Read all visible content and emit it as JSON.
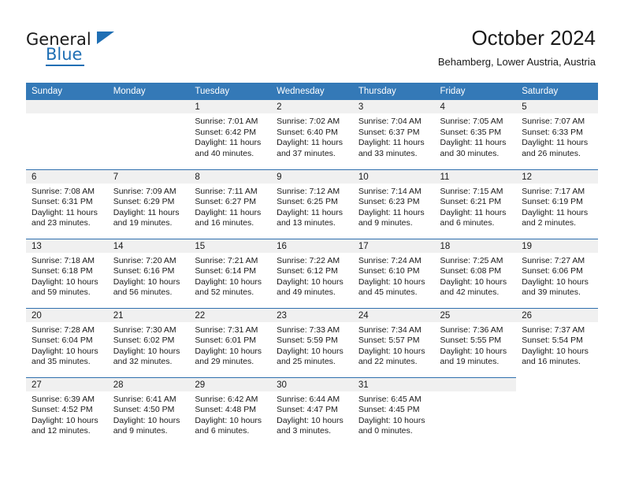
{
  "brand": {
    "name_part1": "General",
    "name_part2": "Blue",
    "accent_color": "#1f6fb4"
  },
  "header": {
    "title": "October 2024",
    "subtitle": "Behamberg, Lower Austria, Austria"
  },
  "calendar": {
    "header_bg": "#3479b7",
    "row_divider_color": "#2f6fae",
    "daynum_band_bg": "#f0f0f0",
    "weekday_headers": [
      "Sunday",
      "Monday",
      "Tuesday",
      "Wednesday",
      "Thursday",
      "Friday",
      "Saturday"
    ],
    "weeks": [
      [
        {
          "day": "",
          "blank": true,
          "sunrise": "",
          "sunset": "",
          "daylight": ""
        },
        {
          "day": "",
          "blank": true,
          "sunrise": "",
          "sunset": "",
          "daylight": ""
        },
        {
          "day": "1",
          "sunrise": "Sunrise: 7:01 AM",
          "sunset": "Sunset: 6:42 PM",
          "daylight": "Daylight: 11 hours and 40 minutes."
        },
        {
          "day": "2",
          "sunrise": "Sunrise: 7:02 AM",
          "sunset": "Sunset: 6:40 PM",
          "daylight": "Daylight: 11 hours and 37 minutes."
        },
        {
          "day": "3",
          "sunrise": "Sunrise: 7:04 AM",
          "sunset": "Sunset: 6:37 PM",
          "daylight": "Daylight: 11 hours and 33 minutes."
        },
        {
          "day": "4",
          "sunrise": "Sunrise: 7:05 AM",
          "sunset": "Sunset: 6:35 PM",
          "daylight": "Daylight: 11 hours and 30 minutes."
        },
        {
          "day": "5",
          "sunrise": "Sunrise: 7:07 AM",
          "sunset": "Sunset: 6:33 PM",
          "daylight": "Daylight: 11 hours and 26 minutes."
        }
      ],
      [
        {
          "day": "6",
          "sunrise": "Sunrise: 7:08 AM",
          "sunset": "Sunset: 6:31 PM",
          "daylight": "Daylight: 11 hours and 23 minutes."
        },
        {
          "day": "7",
          "sunrise": "Sunrise: 7:09 AM",
          "sunset": "Sunset: 6:29 PM",
          "daylight": "Daylight: 11 hours and 19 minutes."
        },
        {
          "day": "8",
          "sunrise": "Sunrise: 7:11 AM",
          "sunset": "Sunset: 6:27 PM",
          "daylight": "Daylight: 11 hours and 16 minutes."
        },
        {
          "day": "9",
          "sunrise": "Sunrise: 7:12 AM",
          "sunset": "Sunset: 6:25 PM",
          "daylight": "Daylight: 11 hours and 13 minutes."
        },
        {
          "day": "10",
          "sunrise": "Sunrise: 7:14 AM",
          "sunset": "Sunset: 6:23 PM",
          "daylight": "Daylight: 11 hours and 9 minutes."
        },
        {
          "day": "11",
          "sunrise": "Sunrise: 7:15 AM",
          "sunset": "Sunset: 6:21 PM",
          "daylight": "Daylight: 11 hours and 6 minutes."
        },
        {
          "day": "12",
          "sunrise": "Sunrise: 7:17 AM",
          "sunset": "Sunset: 6:19 PM",
          "daylight": "Daylight: 11 hours and 2 minutes."
        }
      ],
      [
        {
          "day": "13",
          "sunrise": "Sunrise: 7:18 AM",
          "sunset": "Sunset: 6:18 PM",
          "daylight": "Daylight: 10 hours and 59 minutes."
        },
        {
          "day": "14",
          "sunrise": "Sunrise: 7:20 AM",
          "sunset": "Sunset: 6:16 PM",
          "daylight": "Daylight: 10 hours and 56 minutes."
        },
        {
          "day": "15",
          "sunrise": "Sunrise: 7:21 AM",
          "sunset": "Sunset: 6:14 PM",
          "daylight": "Daylight: 10 hours and 52 minutes."
        },
        {
          "day": "16",
          "sunrise": "Sunrise: 7:22 AM",
          "sunset": "Sunset: 6:12 PM",
          "daylight": "Daylight: 10 hours and 49 minutes."
        },
        {
          "day": "17",
          "sunrise": "Sunrise: 7:24 AM",
          "sunset": "Sunset: 6:10 PM",
          "daylight": "Daylight: 10 hours and 45 minutes."
        },
        {
          "day": "18",
          "sunrise": "Sunrise: 7:25 AM",
          "sunset": "Sunset: 6:08 PM",
          "daylight": "Daylight: 10 hours and 42 minutes."
        },
        {
          "day": "19",
          "sunrise": "Sunrise: 7:27 AM",
          "sunset": "Sunset: 6:06 PM",
          "daylight": "Daylight: 10 hours and 39 minutes."
        }
      ],
      [
        {
          "day": "20",
          "sunrise": "Sunrise: 7:28 AM",
          "sunset": "Sunset: 6:04 PM",
          "daylight": "Daylight: 10 hours and 35 minutes."
        },
        {
          "day": "21",
          "sunrise": "Sunrise: 7:30 AM",
          "sunset": "Sunset: 6:02 PM",
          "daylight": "Daylight: 10 hours and 32 minutes."
        },
        {
          "day": "22",
          "sunrise": "Sunrise: 7:31 AM",
          "sunset": "Sunset: 6:01 PM",
          "daylight": "Daylight: 10 hours and 29 minutes."
        },
        {
          "day": "23",
          "sunrise": "Sunrise: 7:33 AM",
          "sunset": "Sunset: 5:59 PM",
          "daylight": "Daylight: 10 hours and 25 minutes."
        },
        {
          "day": "24",
          "sunrise": "Sunrise: 7:34 AM",
          "sunset": "Sunset: 5:57 PM",
          "daylight": "Daylight: 10 hours and 22 minutes."
        },
        {
          "day": "25",
          "sunrise": "Sunrise: 7:36 AM",
          "sunset": "Sunset: 5:55 PM",
          "daylight": "Daylight: 10 hours and 19 minutes."
        },
        {
          "day": "26",
          "sunrise": "Sunrise: 7:37 AM",
          "sunset": "Sunset: 5:54 PM",
          "daylight": "Daylight: 10 hours and 16 minutes."
        }
      ],
      [
        {
          "day": "27",
          "sunrise": "Sunrise: 6:39 AM",
          "sunset": "Sunset: 4:52 PM",
          "daylight": "Daylight: 10 hours and 12 minutes."
        },
        {
          "day": "28",
          "sunrise": "Sunrise: 6:41 AM",
          "sunset": "Sunset: 4:50 PM",
          "daylight": "Daylight: 10 hours and 9 minutes."
        },
        {
          "day": "29",
          "sunrise": "Sunrise: 6:42 AM",
          "sunset": "Sunset: 4:48 PM",
          "daylight": "Daylight: 10 hours and 6 minutes."
        },
        {
          "day": "30",
          "sunrise": "Sunrise: 6:44 AM",
          "sunset": "Sunset: 4:47 PM",
          "daylight": "Daylight: 10 hours and 3 minutes."
        },
        {
          "day": "31",
          "sunrise": "Sunrise: 6:45 AM",
          "sunset": "Sunset: 4:45 PM",
          "daylight": "Daylight: 10 hours and 0 minutes."
        },
        {
          "day": "",
          "blank": true,
          "sunrise": "",
          "sunset": "",
          "daylight": ""
        },
        {
          "day": "",
          "nocell": true,
          "sunrise": "",
          "sunset": "",
          "daylight": ""
        }
      ]
    ]
  }
}
